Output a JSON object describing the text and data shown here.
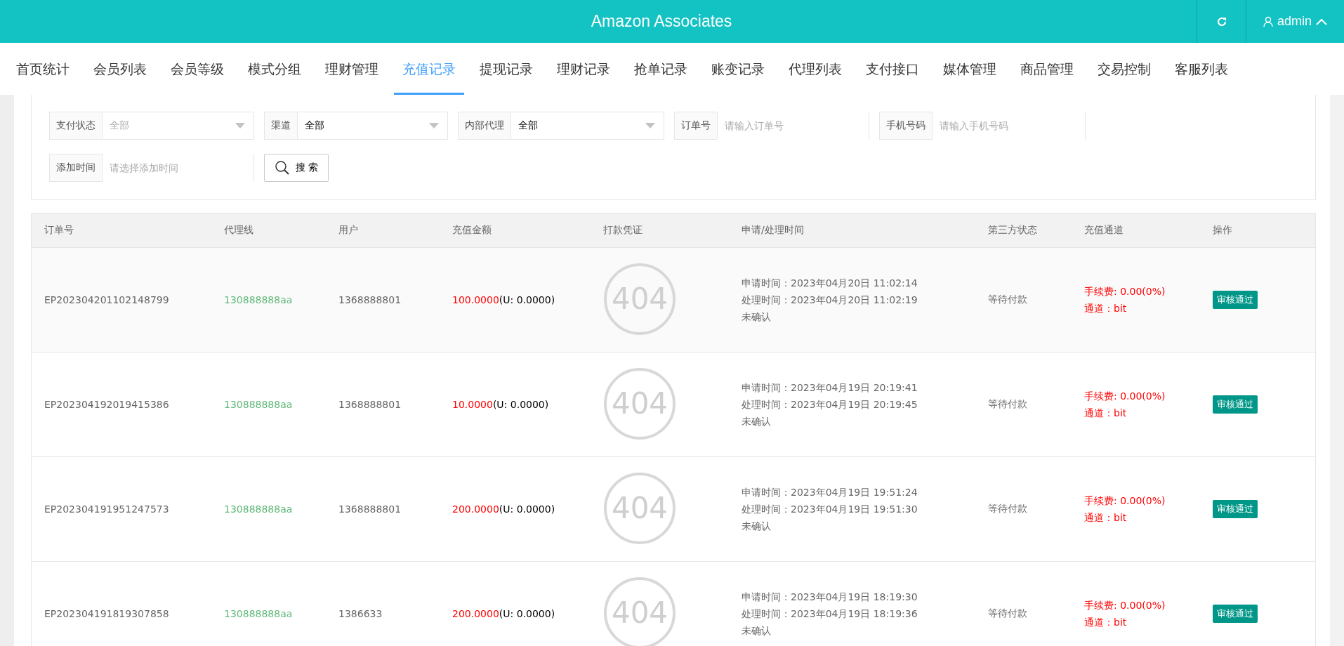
{
  "header": {
    "title": "Amazon Associates",
    "user": "admin"
  },
  "nav": [
    {
      "label": "首页统计",
      "selected": false
    },
    {
      "label": "会员列表",
      "selected": false
    },
    {
      "label": "会员等级",
      "selected": false
    },
    {
      "label": "模式分组",
      "selected": false
    },
    {
      "label": "理财管理",
      "selected": false
    },
    {
      "label": "充值记录",
      "selected": true
    },
    {
      "label": "提现记录",
      "selected": false
    },
    {
      "label": "理财记录",
      "selected": false
    },
    {
      "label": "抢单记录",
      "selected": false
    },
    {
      "label": "账变记录",
      "selected": false
    },
    {
      "label": "代理列表",
      "selected": false
    },
    {
      "label": "支付接口",
      "selected": false
    },
    {
      "label": "媒体管理",
      "selected": false
    },
    {
      "label": "商品管理",
      "selected": false
    },
    {
      "label": "交易控制",
      "selected": false
    },
    {
      "label": "客服列表",
      "selected": false
    }
  ],
  "search": {
    "fields": [
      {
        "kind": "select",
        "label": "支付状态",
        "value": "全部",
        "muted": true
      },
      {
        "kind": "select",
        "label": "渠道",
        "value": "全部",
        "muted": false
      },
      {
        "kind": "select",
        "label": "内部代理",
        "value": "全部",
        "muted": false
      },
      {
        "kind": "input",
        "label": "订单号",
        "placeholder": "请输入订单号"
      },
      {
        "kind": "input",
        "label": "手机号码",
        "placeholder": "请输入手机号码"
      },
      {
        "kind": "input",
        "label": "添加时间",
        "placeholder": "请选择添加时间"
      }
    ],
    "button": "搜 索"
  },
  "table": {
    "columns": [
      "订单号",
      "代理线",
      "用户",
      "充值金额",
      "打款凭证",
      "申请/处理时间",
      "第三方状态",
      "充值通道",
      "操作"
    ],
    "rows": [
      {
        "order": "EP202304201102148799",
        "agent": "130888888aa",
        "user": "1368888801",
        "amount": "100.0000",
        "usdt": "(U: 0.0000)",
        "proof": "404",
        "applied": "申请时间：2023年04月20日 11:02:14",
        "processed": "处理时间：2023年04月20日 11:02:19",
        "confirm": "未确认",
        "status": "等待付款",
        "fee": "手续费: 0.00(0%)",
        "channel": "通道：bit",
        "action": "审核通过"
      },
      {
        "order": "EP202304192019415386",
        "agent": "130888888aa",
        "user": "1368888801",
        "amount": "10.0000",
        "usdt": "(U: 0.0000)",
        "proof": "404",
        "applied": "申请时间：2023年04月19日 20:19:41",
        "processed": "处理时间：2023年04月19日 20:19:45",
        "confirm": "未确认",
        "status": "等待付款",
        "fee": "手续费: 0.00(0%)",
        "channel": "通道：bit",
        "action": "审核通过"
      },
      {
        "order": "EP202304191951247573",
        "agent": "130888888aa",
        "user": "1368888801",
        "amount": "200.0000",
        "usdt": "(U: 0.0000)",
        "proof": "404",
        "applied": "申请时间：2023年04月19日 19:51:24",
        "processed": "处理时间：2023年04月19日 19:51:30",
        "confirm": "未确认",
        "status": "等待付款",
        "fee": "手续费: 0.00(0%)",
        "channel": "通道：bit",
        "action": "审核通过"
      },
      {
        "order": "EP202304191819307858",
        "agent": "130888888aa",
        "user": "1386633",
        "amount": "200.0000",
        "usdt": "(U: 0.0000)",
        "proof": "404",
        "applied": "申请时间：2023年04月19日 18:19:30",
        "processed": "处理时间：2023年04月19日 18:19:36",
        "confirm": "未确认",
        "status": "等待付款",
        "fee": "手续费: 0.00(0%)",
        "channel": "通道：bit",
        "action": "审核通过"
      }
    ]
  }
}
